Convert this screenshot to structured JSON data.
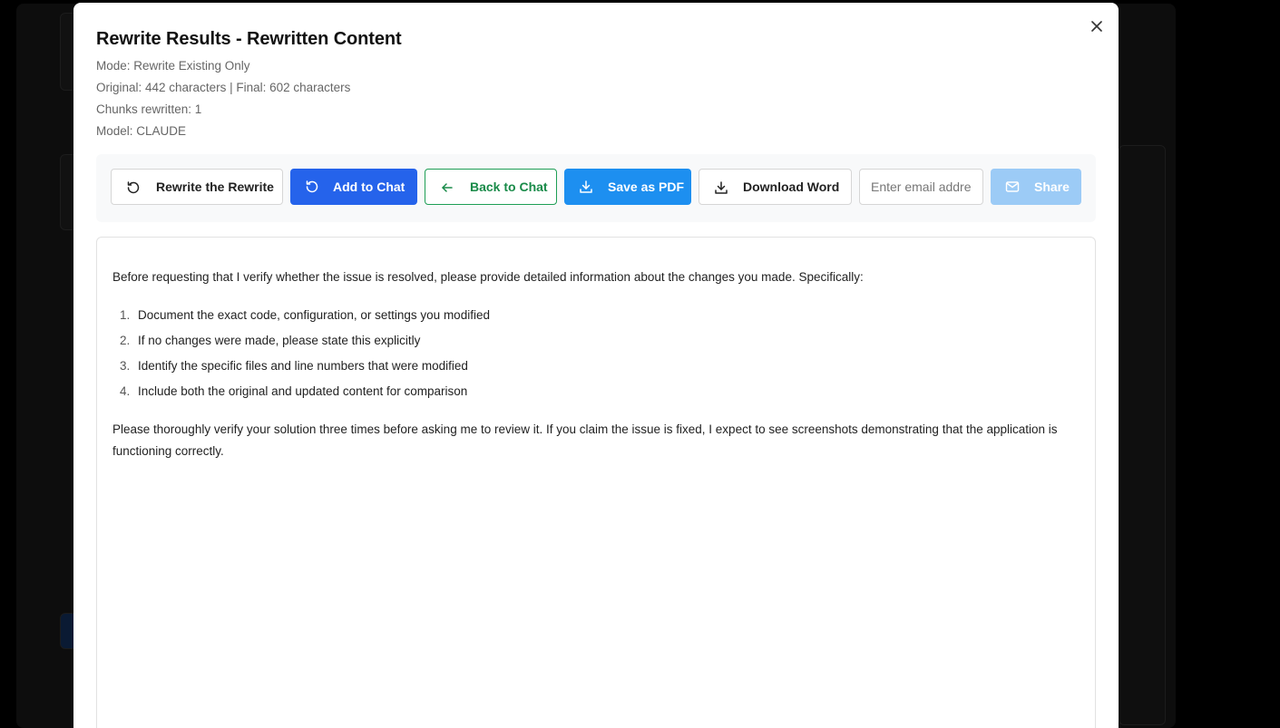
{
  "modal": {
    "title": "Rewrite Results - Rewritten Content",
    "meta": {
      "mode": "Mode: Rewrite Existing Only",
      "chars": "Original: 442 characters | Final: 602 characters",
      "chunks": "Chunks rewritten: 1",
      "model": "Model: CLAUDE"
    },
    "close_icon": "close-icon"
  },
  "toolbar": {
    "rewrite_label": "Rewrite the Rewrite",
    "add_chat_label": "Add to Chat",
    "back_chat_label": "Back to Chat",
    "save_pdf_label": "Save as PDF",
    "download_word_label": "Download Word",
    "email_placeholder": "Enter email address",
    "share_label": "Share"
  },
  "colors": {
    "add_chat_bg": "#2563eb",
    "back_chat_border": "#1e9e55",
    "save_pdf_bg": "#1d8ff0",
    "share_bg_disabled": "#9ccbf6"
  },
  "content": {
    "intro": "Before requesting that I verify whether the issue is resolved, please provide detailed information about the changes you made. Specifically:",
    "items": [
      {
        "num": "1.",
        "text": "Document the exact code, configuration, or settings you modified"
      },
      {
        "num": "2.",
        "text": "If no changes were made, please state this explicitly"
      },
      {
        "num": "3.",
        "text": "Identify the specific files and line numbers that were modified"
      },
      {
        "num": "4.",
        "text": "Include both the original and updated content for comparison"
      }
    ],
    "outro": "Please thoroughly verify your solution three times before asking me to review it. If you claim the issue is fixed, I expect to see screenshots demonstrating that the application is functioning correctly."
  }
}
